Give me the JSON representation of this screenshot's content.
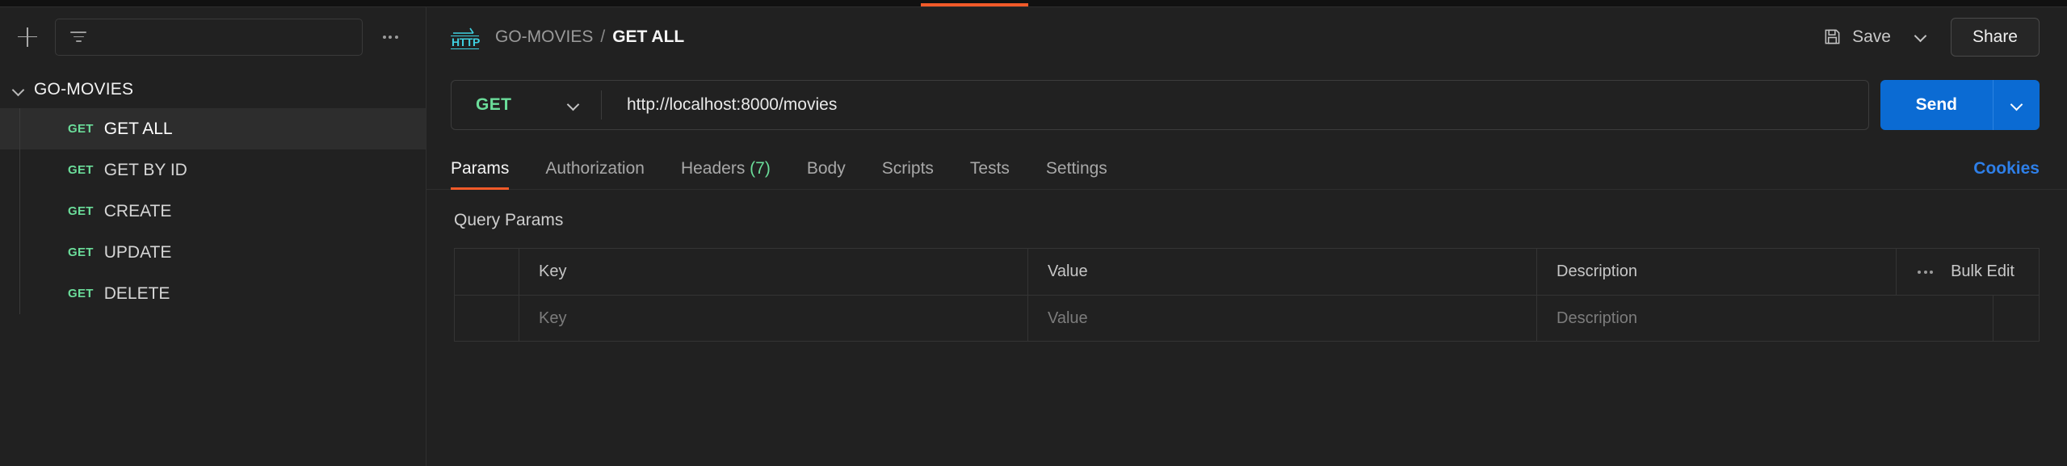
{
  "window": {
    "active_tab_indicator_color": "#f15a29",
    "background": "#212121"
  },
  "sidebar": {
    "toolbar": {
      "new_label": "+",
      "filter_icon": "funnel-icon",
      "more_icon": "kebab-icon"
    },
    "collection": {
      "name": "GO-MOVIES",
      "expanded": true
    },
    "requests": [
      {
        "method": "GET",
        "name": "GET ALL",
        "selected": true
      },
      {
        "method": "GET",
        "name": "GET BY ID",
        "selected": false
      },
      {
        "method": "GET",
        "name": "CREATE",
        "selected": false
      },
      {
        "method": "GET",
        "name": "UPDATE",
        "selected": false
      },
      {
        "method": "GET",
        "name": "DELETE",
        "selected": false
      }
    ],
    "method_color": "#6bdd9a"
  },
  "header": {
    "protocol_icon": "http-icon",
    "breadcrumb_parent": "GO-MOVIES",
    "breadcrumb_separator": "/",
    "breadcrumb_current": "GET ALL",
    "save_label": "Save",
    "save_icon": "floppy-disk-icon",
    "save_caret_icon": "chevron-down-icon",
    "share_label": "Share"
  },
  "request": {
    "method": "GET",
    "method_caret_icon": "chevron-down-icon",
    "url": "http://localhost:8000/movies",
    "send_label": "Send",
    "send_caret_icon": "chevron-down-icon",
    "send_color": "#0b6bd3"
  },
  "tabs": {
    "items": [
      {
        "label": "Params",
        "active": true,
        "count": ""
      },
      {
        "label": "Authorization",
        "active": false,
        "count": ""
      },
      {
        "label": "Headers",
        "active": false,
        "count": "(7)"
      },
      {
        "label": "Body",
        "active": false,
        "count": ""
      },
      {
        "label": "Scripts",
        "active": false,
        "count": ""
      },
      {
        "label": "Tests",
        "active": false,
        "count": ""
      },
      {
        "label": "Settings",
        "active": false,
        "count": ""
      }
    ],
    "cookies_label": "Cookies",
    "cookies_color": "#2e7fe8",
    "count_color": "#6bdd9a",
    "active_underline_color": "#f15a29"
  },
  "params": {
    "section_title": "Query Params",
    "columns": {
      "key": "Key",
      "value": "Value",
      "description": "Description"
    },
    "more_icon": "kebab-icon",
    "bulk_edit_label": "Bulk Edit",
    "rows": [
      {
        "key_placeholder": "Key",
        "value_placeholder": "Value",
        "description_placeholder": "Description"
      }
    ]
  }
}
